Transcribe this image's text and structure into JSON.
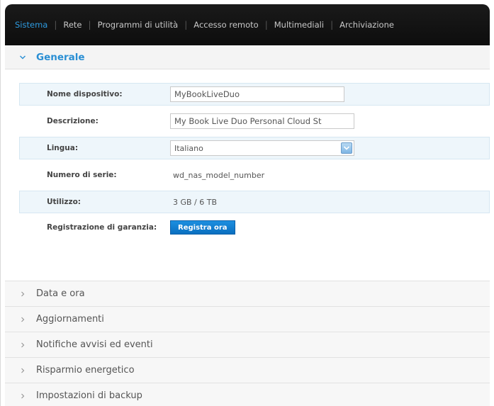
{
  "nav": {
    "items": [
      "Sistema",
      "Rete",
      "Programmi di utilità",
      "Accesso remoto",
      "Multimediali",
      "Archiviazione"
    ],
    "active_index": 0
  },
  "section": {
    "title": "Generale",
    "expanded": true
  },
  "form": {
    "device_name": {
      "label": "Nome dispositivo:",
      "value": "MyBookLiveDuo"
    },
    "description": {
      "label": "Descrizione:",
      "value": "My Book Live Duo Personal Cloud St"
    },
    "language": {
      "label": "Lingua:",
      "value": "Italiano"
    },
    "serial": {
      "label": "Numero di serie:",
      "value": "wd_nas_model_number"
    },
    "usage": {
      "label": "Utilizzo:",
      "value": "3 GB / 6 TB"
    },
    "warranty": {
      "label": "Registrazione di garanzia:",
      "button_label": "Registra ora"
    }
  },
  "collapsed_sections": [
    {
      "title": "Data e ora"
    },
    {
      "title": "Aggiornamenti"
    },
    {
      "title": "Notifiche avvisi ed eventi"
    },
    {
      "title": "Risparmio energetico"
    },
    {
      "title": "Impostazioni di backup"
    }
  ],
  "colors": {
    "accent": "#2a8fd4",
    "nav_bg": "#111111",
    "button": "#1d8fe0",
    "row_shade": "#eef6fb"
  },
  "icons": {
    "expanded": "chevron-down-icon",
    "collapsed": "chevron-right-icon",
    "select": "select-arrow-icon"
  }
}
